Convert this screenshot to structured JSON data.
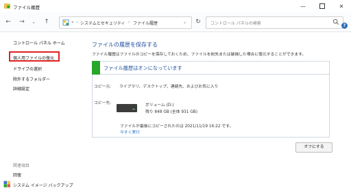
{
  "window": {
    "title": "ファイル履歴"
  },
  "address": {
    "crumbs": [
      "システムとセキュリティ",
      "ファイル履歴"
    ],
    "separator": "›"
  },
  "search": {
    "placeholder": "コントロール パネルの検索"
  },
  "sidebar": {
    "home": "コントロール パネル ホーム",
    "items": [
      {
        "label": "個人用ファイルの復元"
      },
      {
        "label": "ドライブの選択"
      },
      {
        "label": "除外するフォルダー"
      },
      {
        "label": "詳細設定"
      }
    ],
    "related_header": "関連項目",
    "footer_items": [
      {
        "label": "回復"
      },
      {
        "label": "システム イメージ バックアップ"
      }
    ]
  },
  "main": {
    "heading": "ファイルの履歴を保存する",
    "description": "ファイル履歴はファイルのコピーを保存しておくため、ファイルを紛失または破損した場合に復元することができます。",
    "status": "ファイル履歴はオンになっています",
    "copy_from_label": "コピー元:",
    "copy_from_value": "ライブラリ、デスクトップ、連絡先、およびお気に入り",
    "copy_to_label": "コピー先:",
    "drive_name": "ボリューム (D:)",
    "drive_space": "残り 848 GB (全体 931 GB)",
    "last_copied": "ファイルが最後にコピーされたのは 2021/11/19 16:22 です。",
    "run_now": "今すぐ実行",
    "off_button": "オフにする"
  },
  "colors": {
    "accent_green": "#2aa62a",
    "link_blue": "#1f6fc0",
    "highlight_red": "#e02020"
  }
}
